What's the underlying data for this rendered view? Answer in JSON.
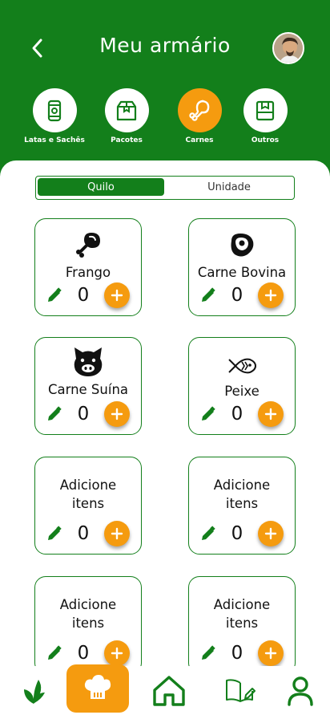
{
  "header": {
    "title": "Meu armário"
  },
  "categories": [
    {
      "label": "Latas e Sachês",
      "icon": "can-icon",
      "active": false
    },
    {
      "label": "Pacotes",
      "icon": "box-icon",
      "active": false
    },
    {
      "label": "Carnes",
      "icon": "drumstick-icon",
      "active": true
    },
    {
      "label": "Outros",
      "icon": "archive-box-icon",
      "active": false
    }
  ],
  "toggle": {
    "option_a": "Quilo",
    "option_b": "Unidade",
    "selected": "Quilo"
  },
  "items": [
    {
      "name": "Frango",
      "icon": "chicken-leg-icon",
      "qty": "0"
    },
    {
      "name": "Carne Bovina",
      "icon": "beef-steak-icon",
      "qty": "0"
    },
    {
      "name": "Carne Suína",
      "icon": "pig-icon",
      "qty": "0"
    },
    {
      "name": "Peixe",
      "icon": "fish-icon",
      "qty": "0"
    },
    {
      "name": "Adicione itens",
      "icon": "",
      "qty": "0"
    },
    {
      "name": "Adicione itens",
      "icon": "",
      "qty": "0"
    },
    {
      "name": "Adicione itens",
      "icon": "",
      "qty": "0"
    },
    {
      "name": "Adicione itens",
      "icon": "",
      "qty": "0"
    }
  ],
  "nav": [
    {
      "icon": "leaves-icon"
    },
    {
      "icon": "chef-hat-icon",
      "active": true
    },
    {
      "icon": "home-icon"
    },
    {
      "icon": "book-edit-icon"
    },
    {
      "icon": "user-icon"
    }
  ],
  "colors": {
    "primary": "#137f1b",
    "accent": "#f59b0f",
    "surface": "#ffffff"
  }
}
